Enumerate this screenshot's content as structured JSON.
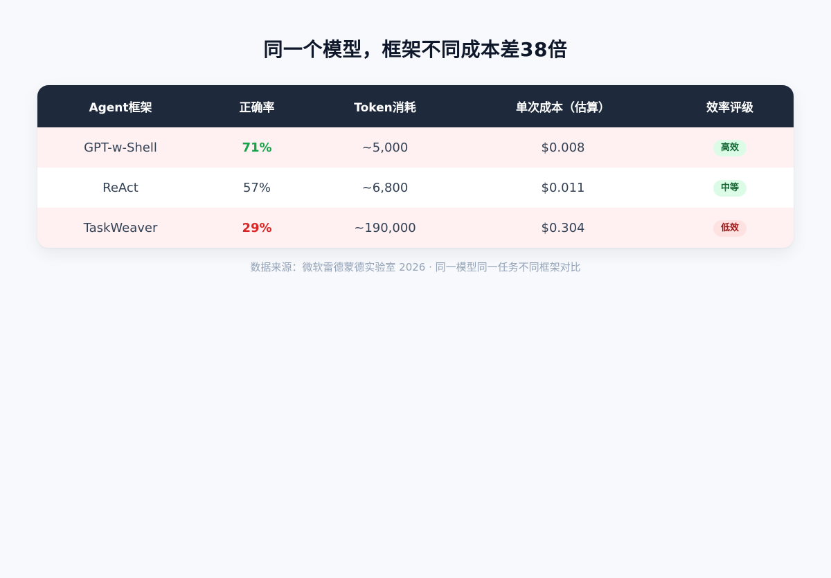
{
  "title": "同一个模型，框架不同成本差38倍",
  "table": {
    "headers": [
      "Agent框架",
      "正确率",
      "Token消耗",
      "单次成本（估算）",
      "效率评级"
    ],
    "rows": [
      {
        "framework": "GPT-w-Shell",
        "accuracy": "71%",
        "accuracy_tone": "good",
        "tokens": "~5,000",
        "cost": "$0.008",
        "rating": "高效",
        "rating_tone": "green",
        "row_tone": "highlight"
      },
      {
        "framework": "ReAct",
        "accuracy": "57%",
        "accuracy_tone": "neutral",
        "tokens": "~6,800",
        "cost": "$0.011",
        "rating": "中等",
        "rating_tone": "green",
        "row_tone": "plain"
      },
      {
        "framework": "TaskWeaver",
        "accuracy": "29%",
        "accuracy_tone": "bad",
        "tokens": "~190,000",
        "cost": "$0.304",
        "rating": "低效",
        "rating_tone": "red",
        "row_tone": "highlight"
      }
    ]
  },
  "source_note": "数据来源：微软雷德蒙德实验室 2026 · 同一模型同一任务不同框架对比",
  "colors": {
    "header_bg": "#1e293b",
    "good": "#16a34a",
    "bad": "#dc2626",
    "highlight_row": "#fff1f1",
    "badge_green_bg": "#dcfce7",
    "badge_red_bg": "#fee2e2"
  }
}
